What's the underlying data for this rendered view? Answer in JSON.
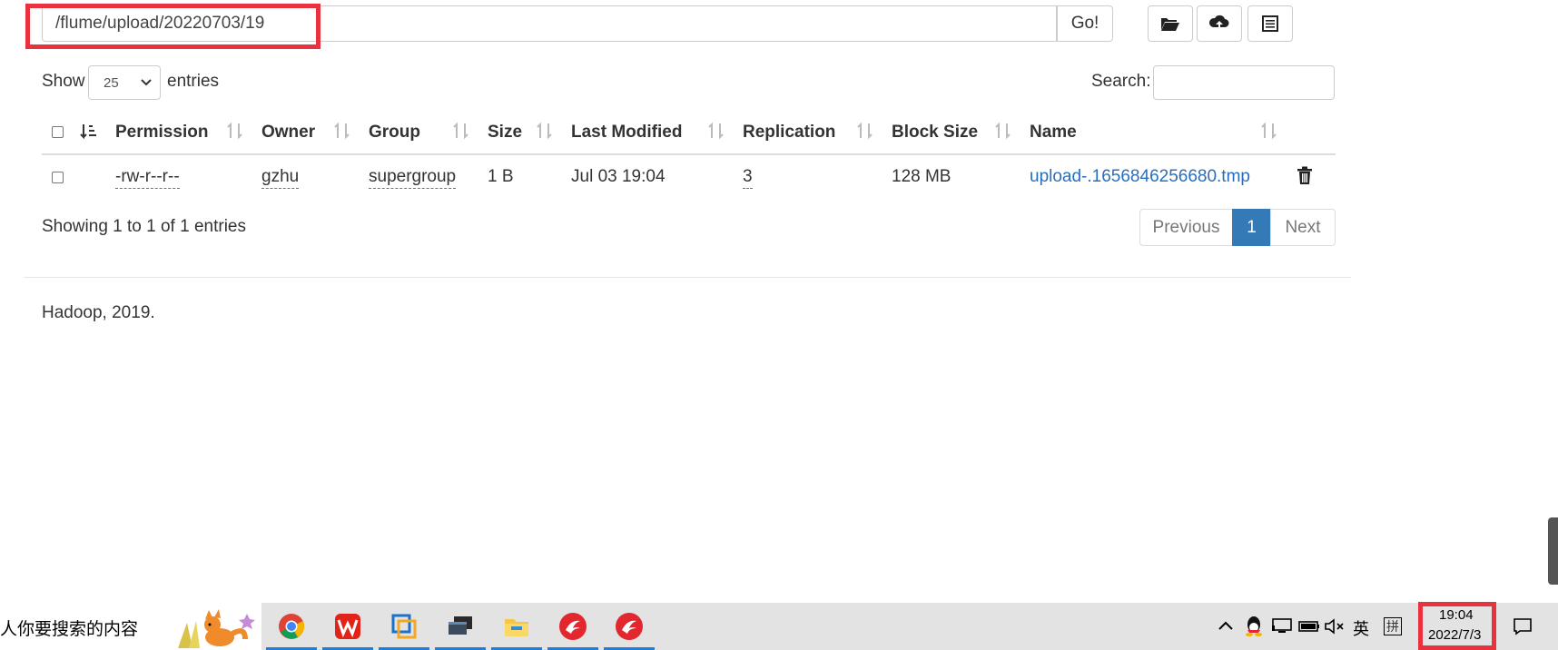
{
  "path_bar": {
    "value": "/flume/upload/20220703/19",
    "go_label": "Go!"
  },
  "toolbar": {
    "icons": [
      "folder-open-icon",
      "cloud-upload-icon",
      "list-icon"
    ]
  },
  "length_menu": {
    "show_label": "Show",
    "selected": "25",
    "entries_label": "entries"
  },
  "search": {
    "label": "Search:",
    "value": ""
  },
  "table": {
    "headers": [
      "Permission",
      "Owner",
      "Group",
      "Size",
      "Last Modified",
      "Replication",
      "Block Size",
      "Name"
    ],
    "rows": [
      {
        "permission": "-rw-r--r--",
        "owner": "gzhu",
        "group": "supergroup",
        "size": "1 B",
        "last_modified": "Jul 03 19:04",
        "replication": "3",
        "block_size": "128 MB",
        "name": "upload-.1656846256680.tmp"
      }
    ]
  },
  "info": "Showing 1 to 1 of 1 entries",
  "pagination": {
    "previous": "Previous",
    "current": "1",
    "next": "Next"
  },
  "footer": "Hadoop, 2019.",
  "taskbar": {
    "search_placeholder": "人你要搜索的内容",
    "apps": [
      "chrome-icon",
      "wps-icon",
      "vmware-icon",
      "terminal-icon",
      "file-explorer-icon",
      "app-icon",
      "app-icon"
    ],
    "tray_lang": "英",
    "tray_ime": "拼",
    "time": "19:04",
    "date": "2022/7/3"
  },
  "colors": {
    "highlight": "#e8323d",
    "link": "#2a6ebb",
    "active_page": "#337ab7",
    "taskbar_accent": "#1f7fd8"
  }
}
